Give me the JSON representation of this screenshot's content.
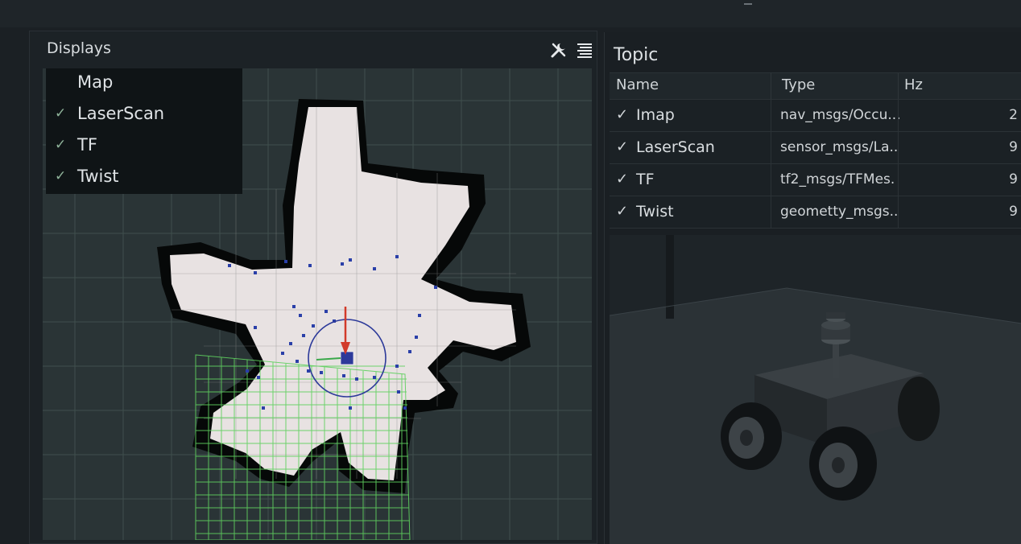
{
  "displays_panel": {
    "title": "Displays",
    "items": [
      {
        "label": "Map",
        "checked": false
      },
      {
        "label": "LaserScan",
        "checked": true
      },
      {
        "label": "TF",
        "checked": true
      },
      {
        "label": "Twist",
        "checked": true
      }
    ],
    "check_glyph": "✓"
  },
  "topic_panel": {
    "title": "Topic",
    "columns": [
      "Name",
      "Type",
      "Hz"
    ],
    "rows": [
      {
        "name": "Imap",
        "type": "nav_msgs/Occu...",
        "hz": "2"
      },
      {
        "name": "LaserScan",
        "type": "sensor_msgs/La..",
        "hz": "9"
      },
      {
        "name": "TF",
        "type": "tf2_msgs/TFMes.",
        "hz": "9"
      },
      {
        "name": "Twist",
        "type": "geometty_msgs..",
        "hz": "9"
      }
    ],
    "check_glyph": "✓"
  },
  "icons": {
    "tools": "tools-icon",
    "list": "list-icon"
  },
  "colors": {
    "map_free": "#e8e2e2",
    "map_occupied": "#060808",
    "grid_green": "#5fd05f",
    "laser_points": "#2a3fa8",
    "arrow": "#d23a2a",
    "circle": "#2d3a9a"
  }
}
